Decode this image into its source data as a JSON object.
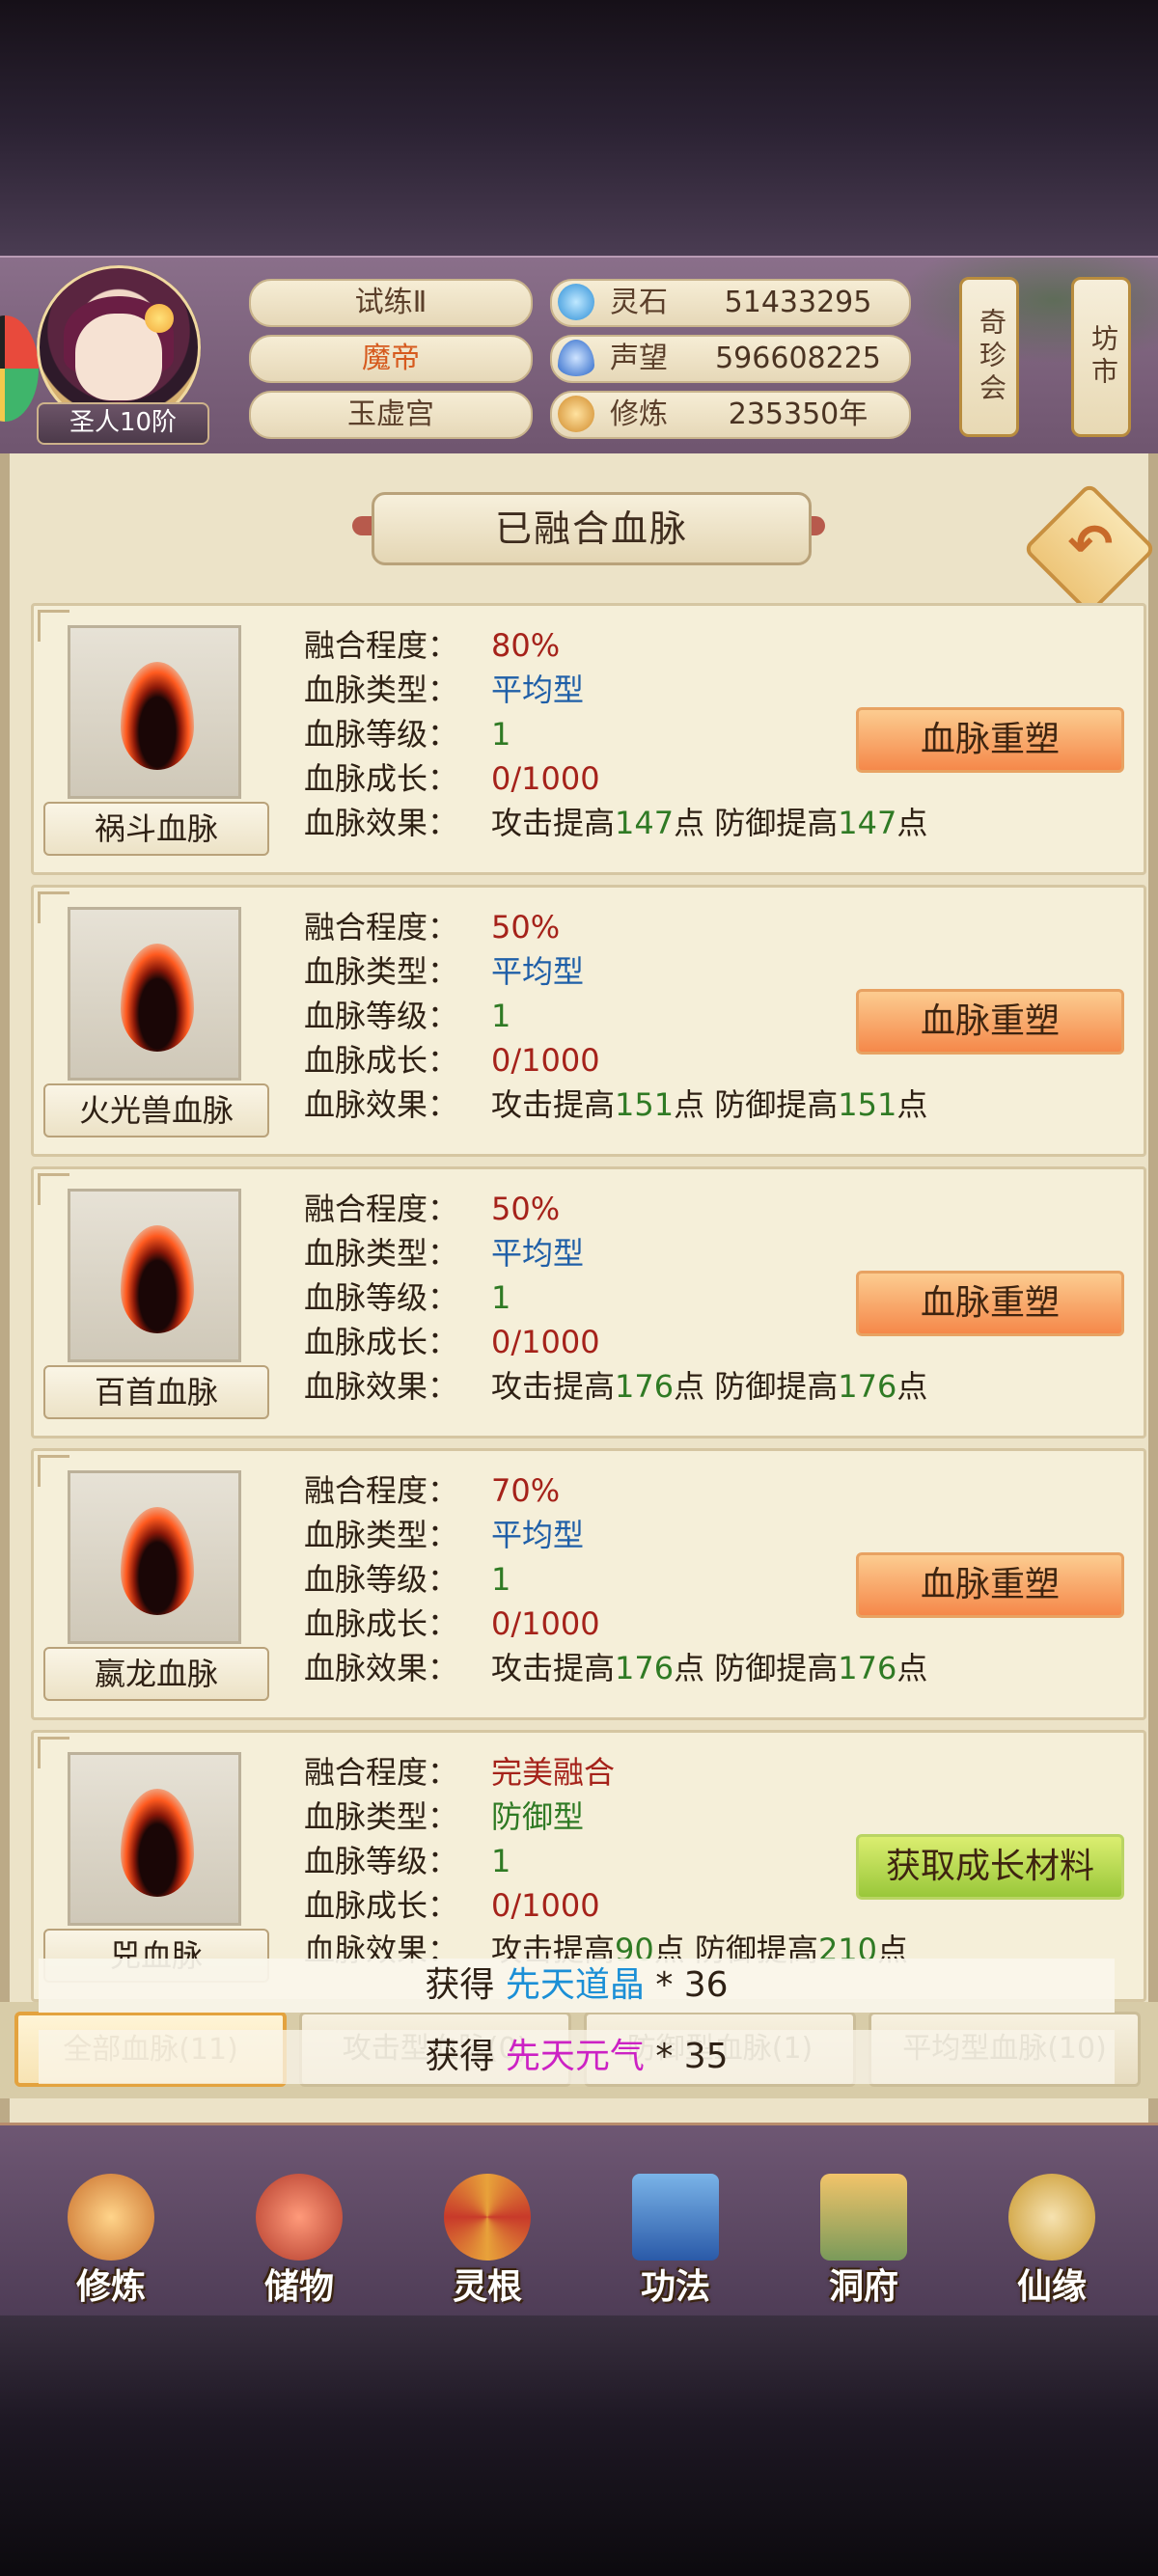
{
  "header": {
    "rank": "圣人10阶",
    "titles": [
      "试练Ⅱ",
      "魔帝",
      "玉虚宫"
    ],
    "resources": [
      {
        "label": "灵石",
        "value": "51433295",
        "icon": "spirit-stone-icon",
        "color": "#3aa0e0"
      },
      {
        "label": "声望",
        "value": "596608225",
        "icon": "reputation-icon",
        "color": "#3a7fd6"
      },
      {
        "label": "修炼",
        "value": "235350年",
        "icon": "meditation-icon",
        "color": "#d99a3a"
      }
    ],
    "side_buttons": [
      "奇珍会",
      "坊市"
    ]
  },
  "panel": {
    "title": "已融合血脉",
    "field_labels": [
      "融合程度：",
      "血脉类型：",
      "血脉等级：",
      "血脉成长：",
      "血脉效果："
    ],
    "cards": [
      {
        "name": "祸斗血脉",
        "fusion": "80%",
        "type": "平均型",
        "level": "1",
        "growth": "0/1000",
        "effect": {
          "atk_prefix": "攻击提高",
          "atk": "147",
          "atk_suffix": "点",
          "def_prefix": "防御提高",
          "def": "147",
          "def_suffix": "点"
        },
        "button": "血脉重塑"
      },
      {
        "name": "火光兽血脉",
        "fusion": "50%",
        "type": "平均型",
        "level": "1",
        "growth": "0/1000",
        "effect": {
          "atk_prefix": "攻击提高",
          "atk": "151",
          "atk_suffix": "点",
          "def_prefix": "防御提高",
          "def": "151",
          "def_suffix": "点"
        },
        "button": "血脉重塑"
      },
      {
        "name": "百首血脉",
        "fusion": "50%",
        "type": "平均型",
        "level": "1",
        "growth": "0/1000",
        "effect": {
          "atk_prefix": "攻击提高",
          "atk": "176",
          "atk_suffix": "点",
          "def_prefix": "防御提高",
          "def": "176",
          "def_suffix": "点"
        },
        "button": "血脉重塑"
      },
      {
        "name": "嬴龙血脉",
        "fusion": "70%",
        "type": "平均型",
        "level": "1",
        "growth": "0/1000",
        "effect": {
          "atk_prefix": "攻击提高",
          "atk": "176",
          "atk_suffix": "点",
          "def_prefix": "防御提高",
          "def": "176",
          "def_suffix": "点"
        },
        "button": "血脉重塑"
      },
      {
        "name": "兕血脉",
        "fusion": "完美融合",
        "type": "防御型",
        "level": "1",
        "growth": "0/1000",
        "effect": {
          "atk_prefix": "攻击提高",
          "atk": "90",
          "atk_suffix": "点",
          "def_prefix": "防御提高",
          "def": "210",
          "def_suffix": "点"
        },
        "button": "获取成长材料"
      }
    ]
  },
  "toasts": [
    {
      "prefix": "获得",
      "item": "先天道晶",
      "count": " * 36",
      "color": "#1b8fd6"
    },
    {
      "prefix": "获得",
      "item": "先天元气",
      "count": " * 35",
      "color": "#cc22c4"
    }
  ],
  "tabs": [
    "全部血脉(11)",
    "攻击型血脉(0)",
    "防御型血脉(1)",
    "平均型血脉(10)"
  ],
  "nav": [
    {
      "label": "修炼",
      "icon": "cultivation-icon"
    },
    {
      "label": "储物",
      "icon": "storage-bag-icon"
    },
    {
      "label": "灵根",
      "icon": "spirit-root-icon"
    },
    {
      "label": "功法",
      "icon": "technique-book-icon"
    },
    {
      "label": "洞府",
      "icon": "cave-mansion-icon"
    },
    {
      "label": "仙缘",
      "icon": "immortal-fate-icon"
    }
  ]
}
